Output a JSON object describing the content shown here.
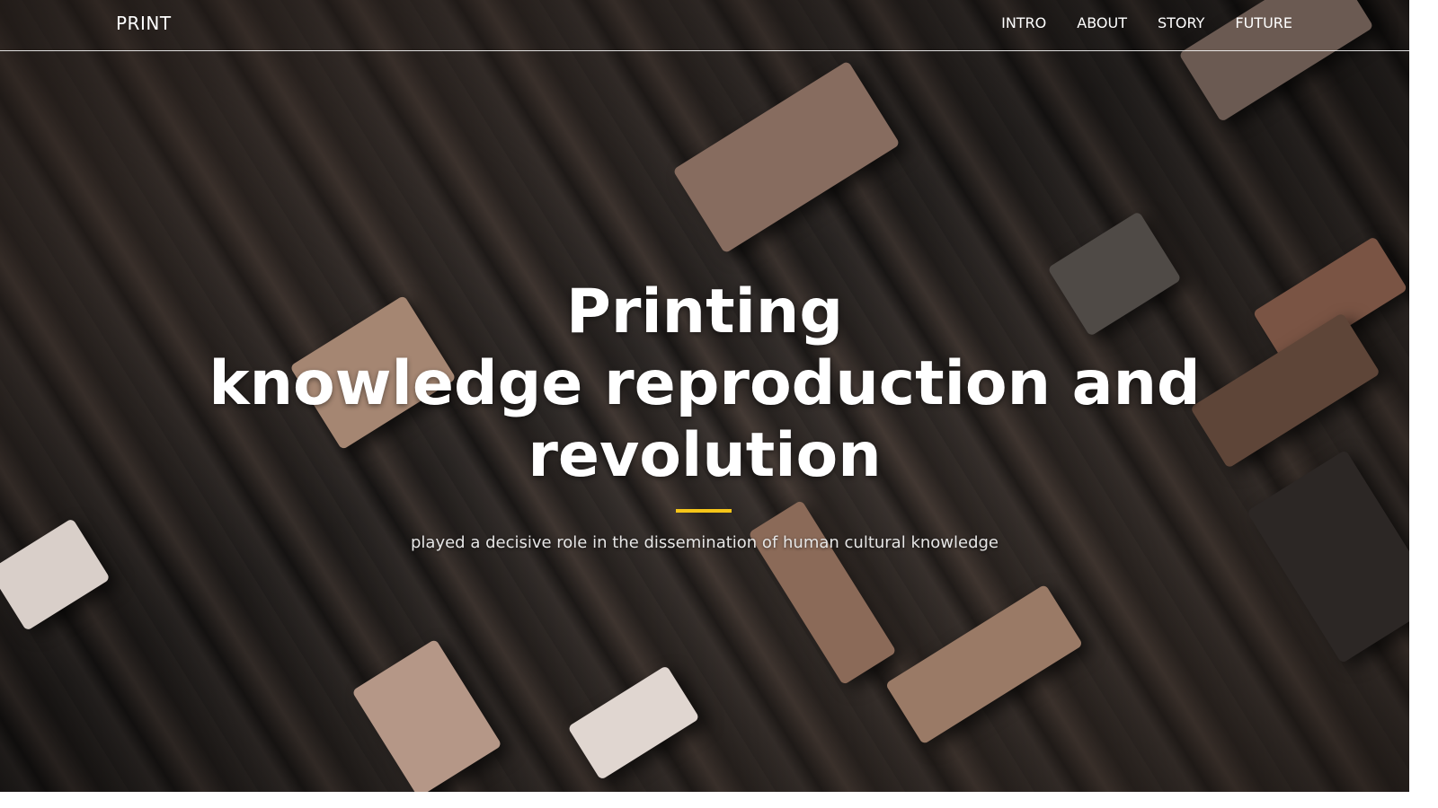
{
  "nav": {
    "brand": "PRINT",
    "items": [
      {
        "label": "INTRO"
      },
      {
        "label": "ABOUT"
      },
      {
        "label": "STORY"
      },
      {
        "label": "FUTURE"
      }
    ]
  },
  "hero": {
    "title_line1": "Printing",
    "title_line2": "knowledge reproduction and",
    "title_line3": "revolution",
    "subtitle": "played a decisive role in the dissemination of human cultural knowledge",
    "accent_color": "#f5c518"
  }
}
